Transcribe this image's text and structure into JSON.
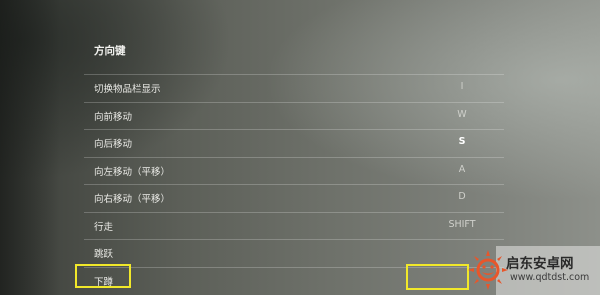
{
  "section": {
    "title": "方向键"
  },
  "bindings": [
    {
      "action": "切换物品栏显示",
      "key": "I",
      "emphasis": false
    },
    {
      "action": "向前移动",
      "key": "W",
      "emphasis": false
    },
    {
      "action": "向后移动",
      "key": "S",
      "emphasis": true
    },
    {
      "action": "向左移动（平移）",
      "key": "A",
      "emphasis": false
    },
    {
      "action": "向右移动（平移）",
      "key": "D",
      "emphasis": false
    },
    {
      "action": "行走",
      "key": "SHIFT",
      "emphasis": false
    },
    {
      "action": "跳跃",
      "key": "",
      "emphasis": false
    },
    {
      "action": "下蹲",
      "key": "",
      "emphasis": false
    }
  ],
  "highlight": {
    "color": "#f1e82a"
  },
  "watermark": {
    "name": "启东安卓网",
    "url": "www.qdtdst.com",
    "accent_color": "#e8562a"
  }
}
